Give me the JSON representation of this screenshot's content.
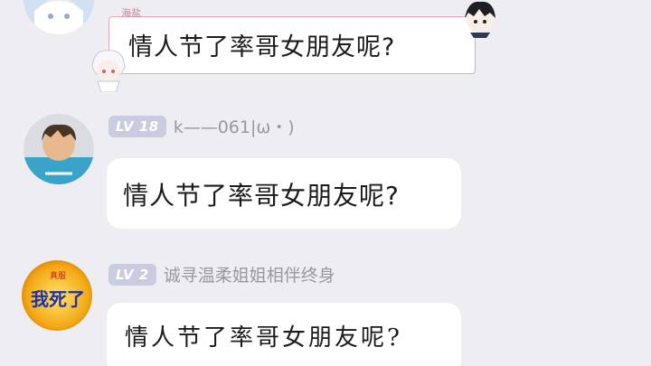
{
  "messages": [
    {
      "id": "msg1",
      "signature": "海盐",
      "text": "情人节了率哥女朋友呢?",
      "bubble_style": "decorated-pink-frame"
    },
    {
      "id": "msg2",
      "level": "LV 18",
      "username": "k——061|ω・)",
      "text": "情人节了率哥女朋友呢?"
    },
    {
      "id": "msg3",
      "level": "LV 2",
      "username": "诚寻温柔姐姐相伴终身",
      "avatar_text_top": "真服",
      "avatar_text_main": "我死了",
      "text": "情人节了率哥女朋友呢?"
    }
  ],
  "colors": {
    "background": "#eeedf2",
    "bubble": "#ffffff",
    "level_badge": "#c9cce0",
    "username": "#98989e",
    "frame_pink": "#e8a7b3",
    "avatar3_bg": "#f2a915",
    "avatar3_text": "#2030a8"
  }
}
